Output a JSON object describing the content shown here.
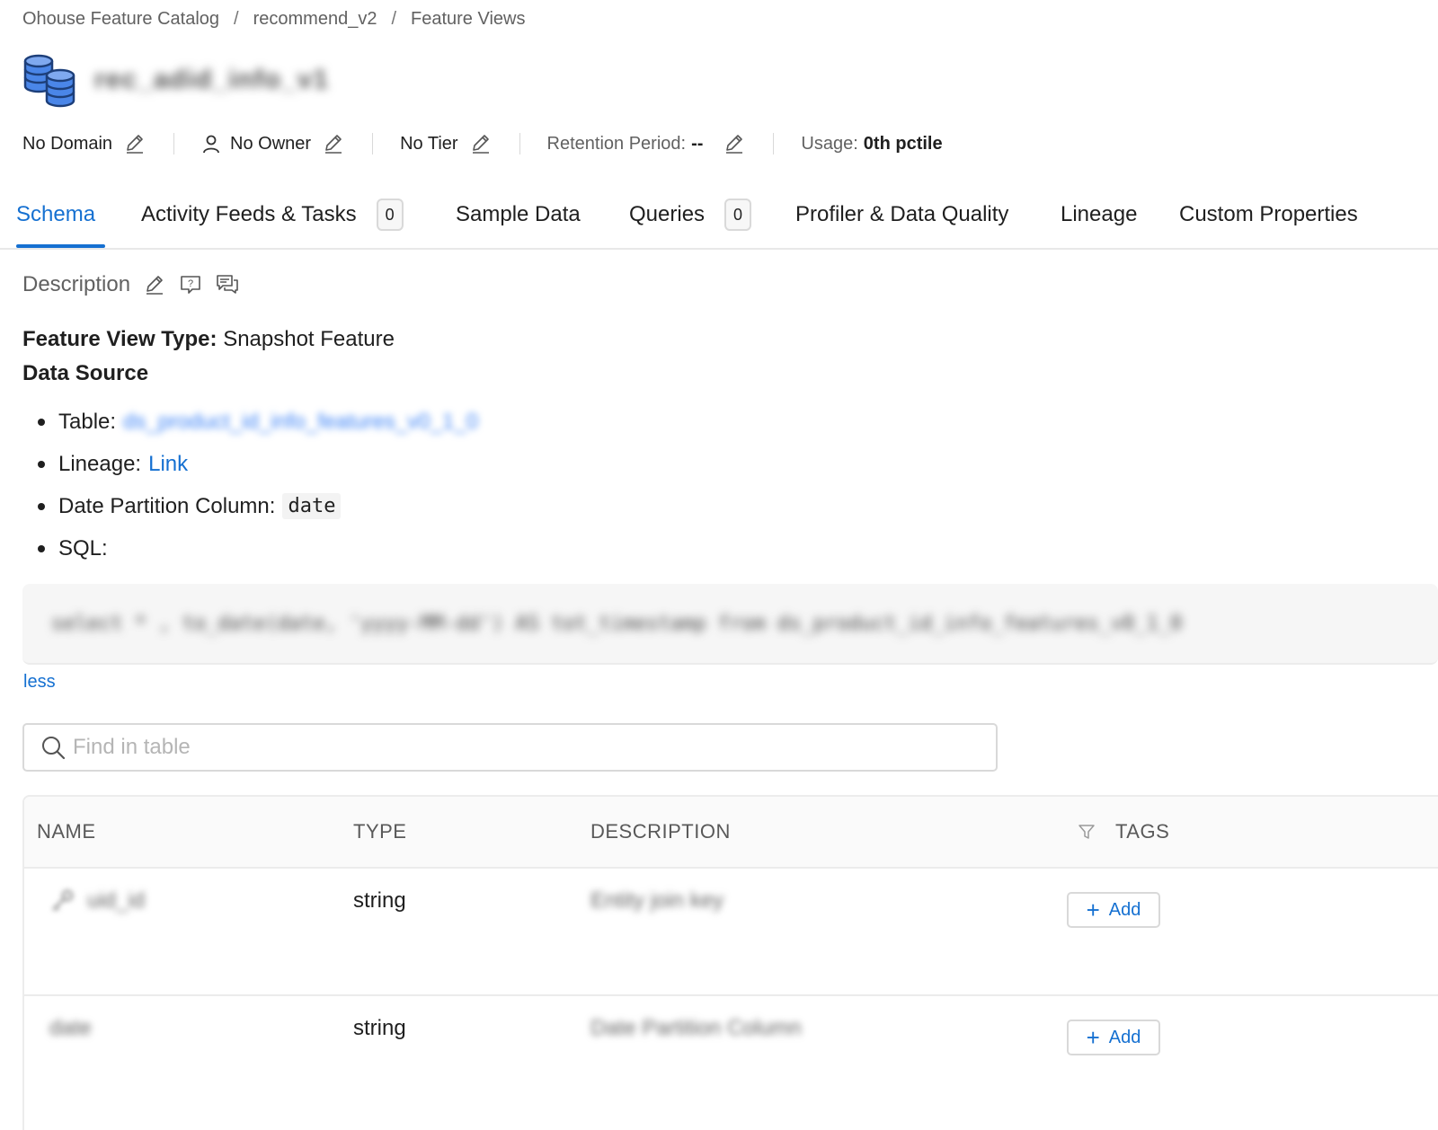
{
  "breadcrumb": {
    "items": [
      "Ohouse Feature Catalog",
      "recommend_v2",
      "Feature Views"
    ],
    "separator": "/"
  },
  "entity": {
    "name": "rec_adid_info_v1",
    "icon": "database-stack-icon"
  },
  "meta": {
    "domain": "No Domain",
    "owner": "No Owner",
    "tier": "No Tier",
    "retention_label": "Retention Period:",
    "retention_value": "--",
    "usage_label": "Usage:",
    "usage_value": "0th pctile"
  },
  "tabs": {
    "schema": "Schema",
    "activity": "Activity Feeds & Tasks",
    "activity_count": "0",
    "sample": "Sample Data",
    "queries": "Queries",
    "queries_count": "0",
    "profiler": "Profiler & Data Quality",
    "lineage": "Lineage",
    "custom": "Custom Properties"
  },
  "description": {
    "heading": "Description",
    "fv_type_label": "Feature View Type:",
    "fv_type_value": "Snapshot Feature",
    "data_source_title": "Data Source",
    "table_label": "Table:",
    "table_value": "ds_product_id_info_features_v0_1_0",
    "lineage_label": "Lineage:",
    "lineage_link": "Link",
    "partition_label": "Date Partition Column:",
    "partition_value": "date",
    "sql_label": "SQL:",
    "sql_text": "select * , to_date(date, 'yyyy-MM-dd') AS tot_timestamp from ds_product_id_info_features_v0_1_0",
    "less_link": "less"
  },
  "search": {
    "placeholder": "Find in table"
  },
  "table": {
    "headers": {
      "name": "NAME",
      "type": "TYPE",
      "description": "DESCRIPTION",
      "tags": "TAGS"
    },
    "rows": [
      {
        "name": "uid_id",
        "type": "string",
        "description": "Entity join key",
        "add": "Add"
      },
      {
        "name": "date",
        "type": "string",
        "description": "Date Partition Column",
        "add": "Add"
      }
    ]
  },
  "colors": {
    "accent": "#1570d1",
    "icon_blue": "#4a86e8"
  }
}
